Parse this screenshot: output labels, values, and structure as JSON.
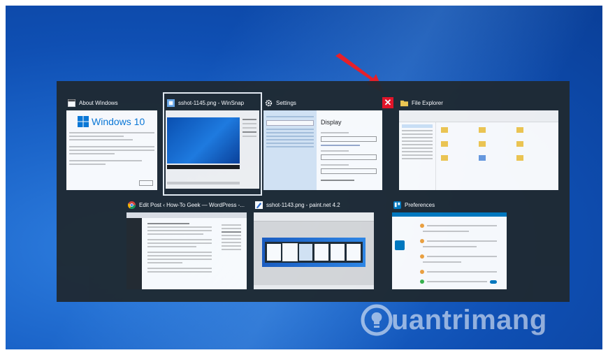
{
  "tiles": [
    {
      "title": "About Windows",
      "icon": "window-icon",
      "preview_text": "Windows 10"
    },
    {
      "title": "sshot-1145.png - WinSnap",
      "icon": "winsnap-icon"
    },
    {
      "title": "Settings",
      "icon": "gear-icon",
      "preview_text": "Display"
    },
    {
      "title": "File Explorer",
      "icon": "folder-icon"
    },
    {
      "title": "Edit Post ‹ How-To Geek — WordPress -...",
      "icon": "chrome-icon"
    },
    {
      "title": "sshot-1143.png - paint.net 4.2",
      "icon": "paintnet-icon"
    },
    {
      "title": "Preferences",
      "icon": "trello-icon"
    }
  ],
  "close_button": {
    "label": "✕"
  },
  "watermark": {
    "brand": "uantrimang"
  },
  "colors": {
    "close": "#e81123",
    "switcher_bg": "#1f2a33",
    "arrow": "#e5202a"
  }
}
